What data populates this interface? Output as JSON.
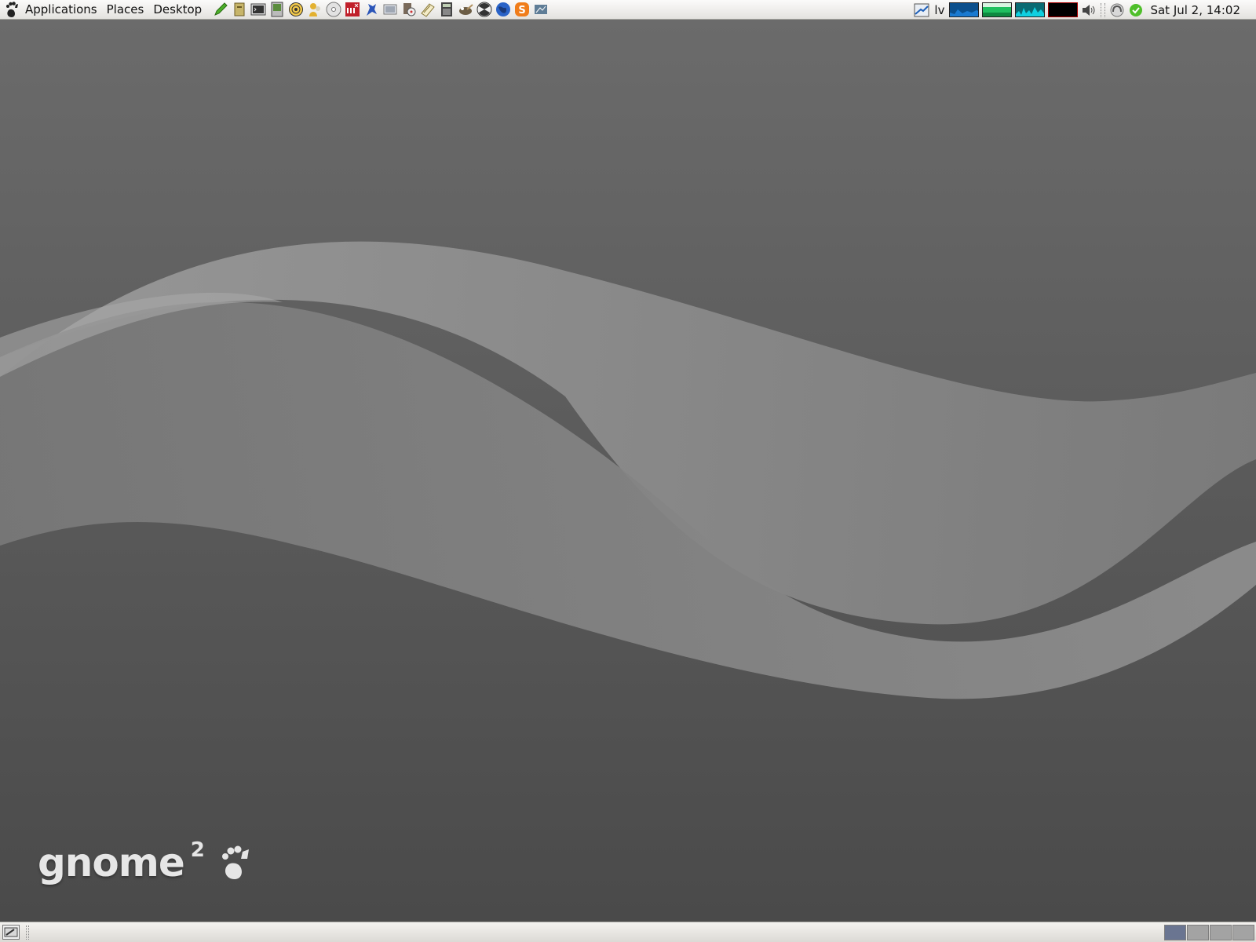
{
  "top_panel": {
    "menus": {
      "applications": "Applications",
      "places": "Places",
      "desktop": "Desktop"
    },
    "launchers": [
      {
        "name": "text-editor-icon",
        "color": "#4caf2a"
      },
      {
        "name": "archive-manager-icon",
        "color": "#c7b56a"
      },
      {
        "name": "terminal-icon",
        "color": "#555555"
      },
      {
        "name": "system-monitor-icon",
        "color": "#5a8c3c"
      },
      {
        "name": "chess-icon",
        "color": "#d1a22a"
      },
      {
        "name": "messenger-icon",
        "color": "#e3b12f"
      },
      {
        "name": "cd-burner-icon",
        "color": "#c8c8c8"
      },
      {
        "name": "dictionary-icon",
        "color": "#c0202a"
      },
      {
        "name": "bird-icon",
        "color": "#2b55b8"
      },
      {
        "name": "screenshot-icon",
        "color": "#9fa7b3"
      },
      {
        "name": "movie-player-icon",
        "color": "#7a6a5a"
      },
      {
        "name": "notes-icon",
        "color": "#d8c27a"
      },
      {
        "name": "calculator-icon",
        "color": "#444444"
      },
      {
        "name": "gimp-icon",
        "color": "#6b5c43"
      },
      {
        "name": "radiation-icon",
        "color": "#333333"
      },
      {
        "name": "web-browser-icon",
        "color": "#2a63c7"
      },
      {
        "name": "skype-icon",
        "color": "#f07d1a"
      },
      {
        "name": "network-icon",
        "color": "#5f7d96"
      }
    ],
    "tray": {
      "keyboard_layout": "lv",
      "clock": "Sat Jul  2, 14:02",
      "monitor_colors": [
        "#0b4f8c",
        "#20c060",
        "#10d0e0",
        "#000000"
      ]
    }
  },
  "desktop": {
    "logo_word": "gnome",
    "logo_version": "2"
  },
  "bottom_panel": {
    "workspace_count": 4,
    "active_workspace": 1
  }
}
